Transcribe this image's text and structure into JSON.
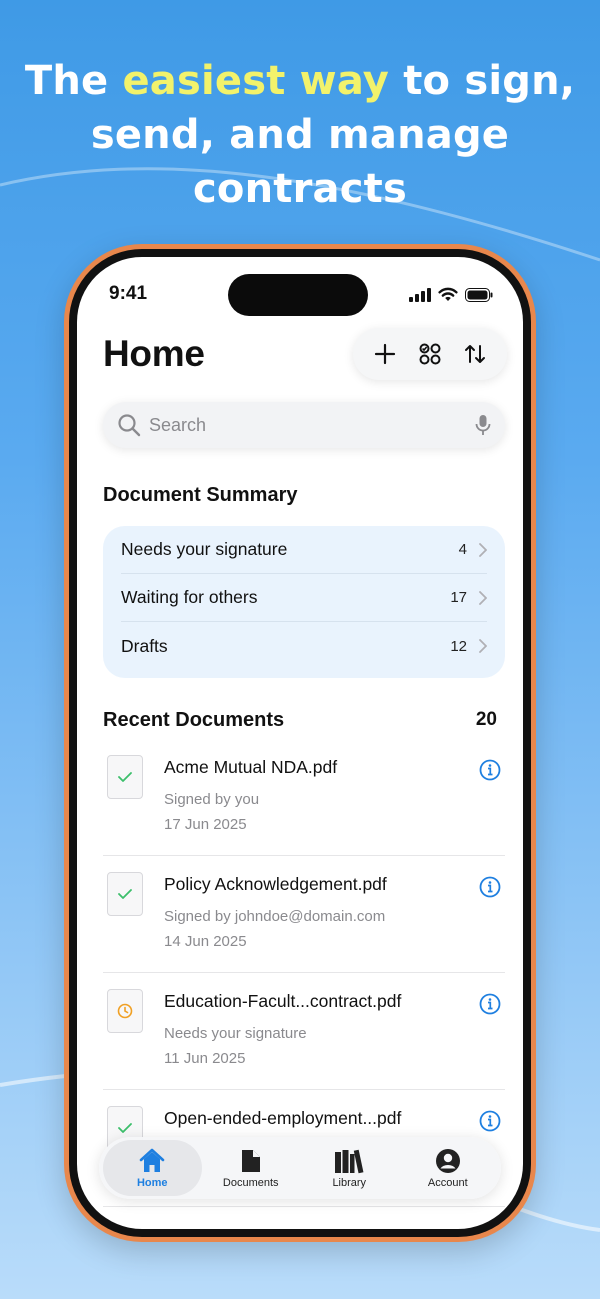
{
  "headline": {
    "prefix": "The ",
    "highlight": "easiest way",
    "rest_line1": " to sign,",
    "line2": "send, and manage",
    "line3": "contracts"
  },
  "status_bar": {
    "time": "9:41"
  },
  "header": {
    "title": "Home"
  },
  "search": {
    "placeholder": "Search"
  },
  "summary": {
    "title": "Document Summary",
    "rows": [
      {
        "label": "Needs your signature",
        "count": "4"
      },
      {
        "label": "Waiting for others",
        "count": "17"
      },
      {
        "label": "Drafts",
        "count": "12"
      }
    ]
  },
  "recent": {
    "title": "Recent Documents",
    "count": "20",
    "items": [
      {
        "name": "Acme Mutual NDA.pdf",
        "status": "Signed by you",
        "date": "17 Jun 2025",
        "state": "signed"
      },
      {
        "name": "Policy Acknowledgement.pdf",
        "status": "Signed by johndoe@domain.com",
        "date": "14 Jun 2025",
        "state": "signed"
      },
      {
        "name": "Education-Facult...contract.pdf",
        "status": "Needs your signature",
        "date": "11 Jun 2025",
        "state": "pending"
      },
      {
        "name": "Open-ended-employment...pdf",
        "status": "",
        "date": "",
        "state": "signed"
      }
    ]
  },
  "tabs": [
    {
      "label": "Home",
      "icon": "home-icon",
      "active": true
    },
    {
      "label": "Documents",
      "icon": "document-icon",
      "active": false
    },
    {
      "label": "Library",
      "icon": "library-icon",
      "active": false
    },
    {
      "label": "Account",
      "icon": "account-icon",
      "active": false
    }
  ],
  "colors": {
    "accent": "#1e7fe0",
    "highlight_text": "#f2f26b",
    "signed_check": "#3cbf6b",
    "pending_clock": "#f0a024",
    "phone_frame": "#e8874c"
  }
}
